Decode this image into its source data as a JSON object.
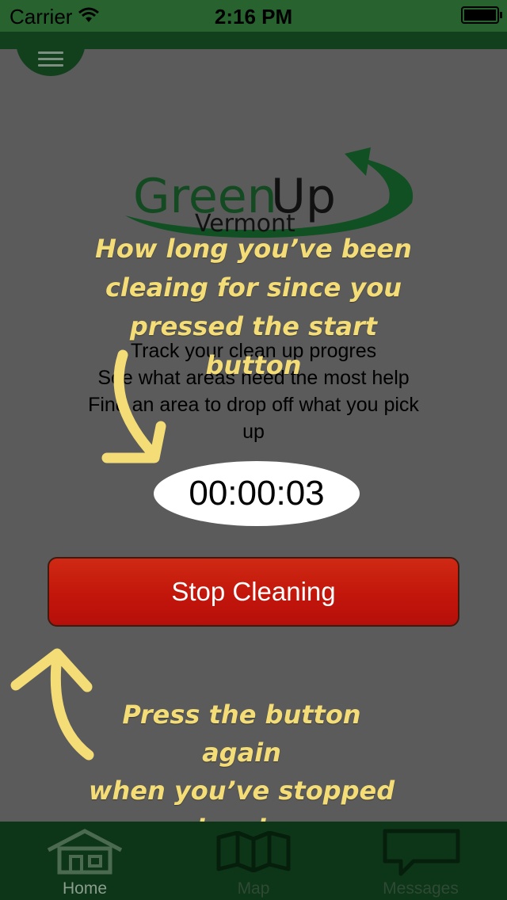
{
  "status_bar": {
    "carrier": "Carrier",
    "time": "2:16 PM"
  },
  "logo": {
    "green": "Green",
    "up": "Up",
    "sub": "Vermont"
  },
  "overlay": {
    "timer_hint": [
      "How long you’ve been",
      "cleaing for since you",
      "pressed the start button"
    ],
    "button_hint": [
      "Press the button again",
      "when you’ve stopped",
      "cleaning"
    ]
  },
  "description": {
    "line1": "Track your clean up progres",
    "line2": "See what areas need the most help",
    "line3": "Find an area to drop off what you pick",
    "line4": "up"
  },
  "timer": {
    "value": "00:00:03"
  },
  "stop_button": {
    "label": "Stop Cleaning"
  },
  "tab_bar": {
    "home": "Home",
    "map": "Map",
    "messages": "Messages",
    "active": "Home"
  },
  "colors": {
    "brand_green": "#13401c",
    "button_red": "#c2160b",
    "hint_yellow": "#f4dd76"
  }
}
